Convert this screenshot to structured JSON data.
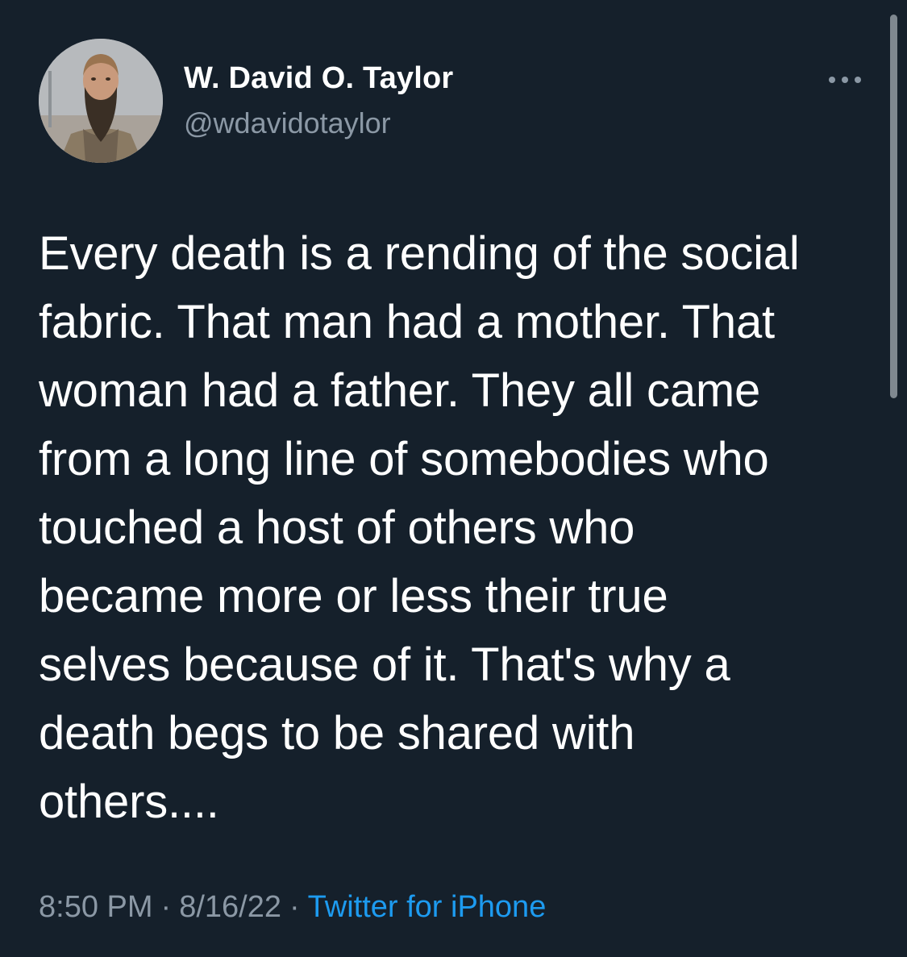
{
  "author": {
    "display_name": "W. David O. Taylor",
    "handle": "@wdavidotaylor"
  },
  "more_icon": "more-horizontal-icon",
  "tweet": {
    "text": "Every death is a rending of the social\nfabric. That man had a mother. That\nwoman had a father. They all came\nfrom a long line of somebodies who\ntouched a host of others who\nbecame more or less their true\nselves because of it. That's why a\ndeath begs to be shared with\nothers...."
  },
  "meta": {
    "time": "8:50 PM",
    "separator": "·",
    "date": "8/16/22",
    "source": "Twitter for iPhone"
  },
  "colors": {
    "background": "#15202b",
    "text": "#ffffff",
    "secondary_text": "#8b98a5",
    "link": "#1d9bf0"
  }
}
